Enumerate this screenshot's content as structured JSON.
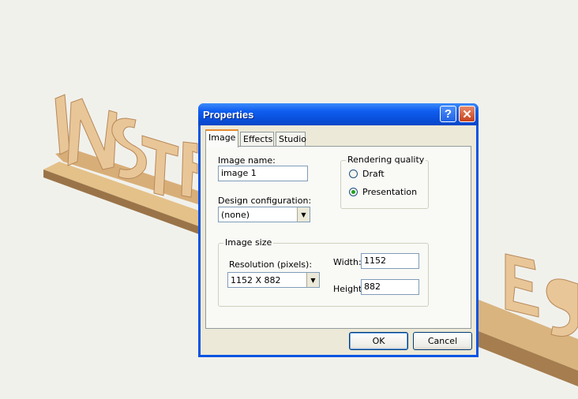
{
  "window": {
    "title": "Properties",
    "help_icon": "?",
    "close_icon": "✕"
  },
  "tabs": [
    {
      "label": "Image",
      "active": true
    },
    {
      "label": "Effects",
      "active": false
    },
    {
      "label": "Studio",
      "active": false
    }
  ],
  "image_tab": {
    "image_name_label": "Image name:",
    "image_name_value": "image 1",
    "design_config_label": "Design configuration:",
    "design_config_value": "(none)",
    "rendering_quality": {
      "title": "Rendering quality",
      "options": [
        {
          "label": "Draft",
          "selected": false
        },
        {
          "label": "Presentation",
          "selected": true
        }
      ]
    },
    "image_size": {
      "title": "Image size",
      "resolution_label": "Resolution (pixels):",
      "resolution_value": "1152 X 882",
      "width_label": "Width:",
      "width_value": "1152",
      "height_label": "Height:",
      "height_value": "882"
    }
  },
  "buttons": {
    "ok": "OK",
    "cancel": "Cancel"
  },
  "colors": {
    "titlebar": "#0a54e3",
    "dialog_bg": "#ece9d8",
    "tab_accent": "#e68b2c",
    "letters": "#e8c090",
    "base": "#c9a06a"
  }
}
